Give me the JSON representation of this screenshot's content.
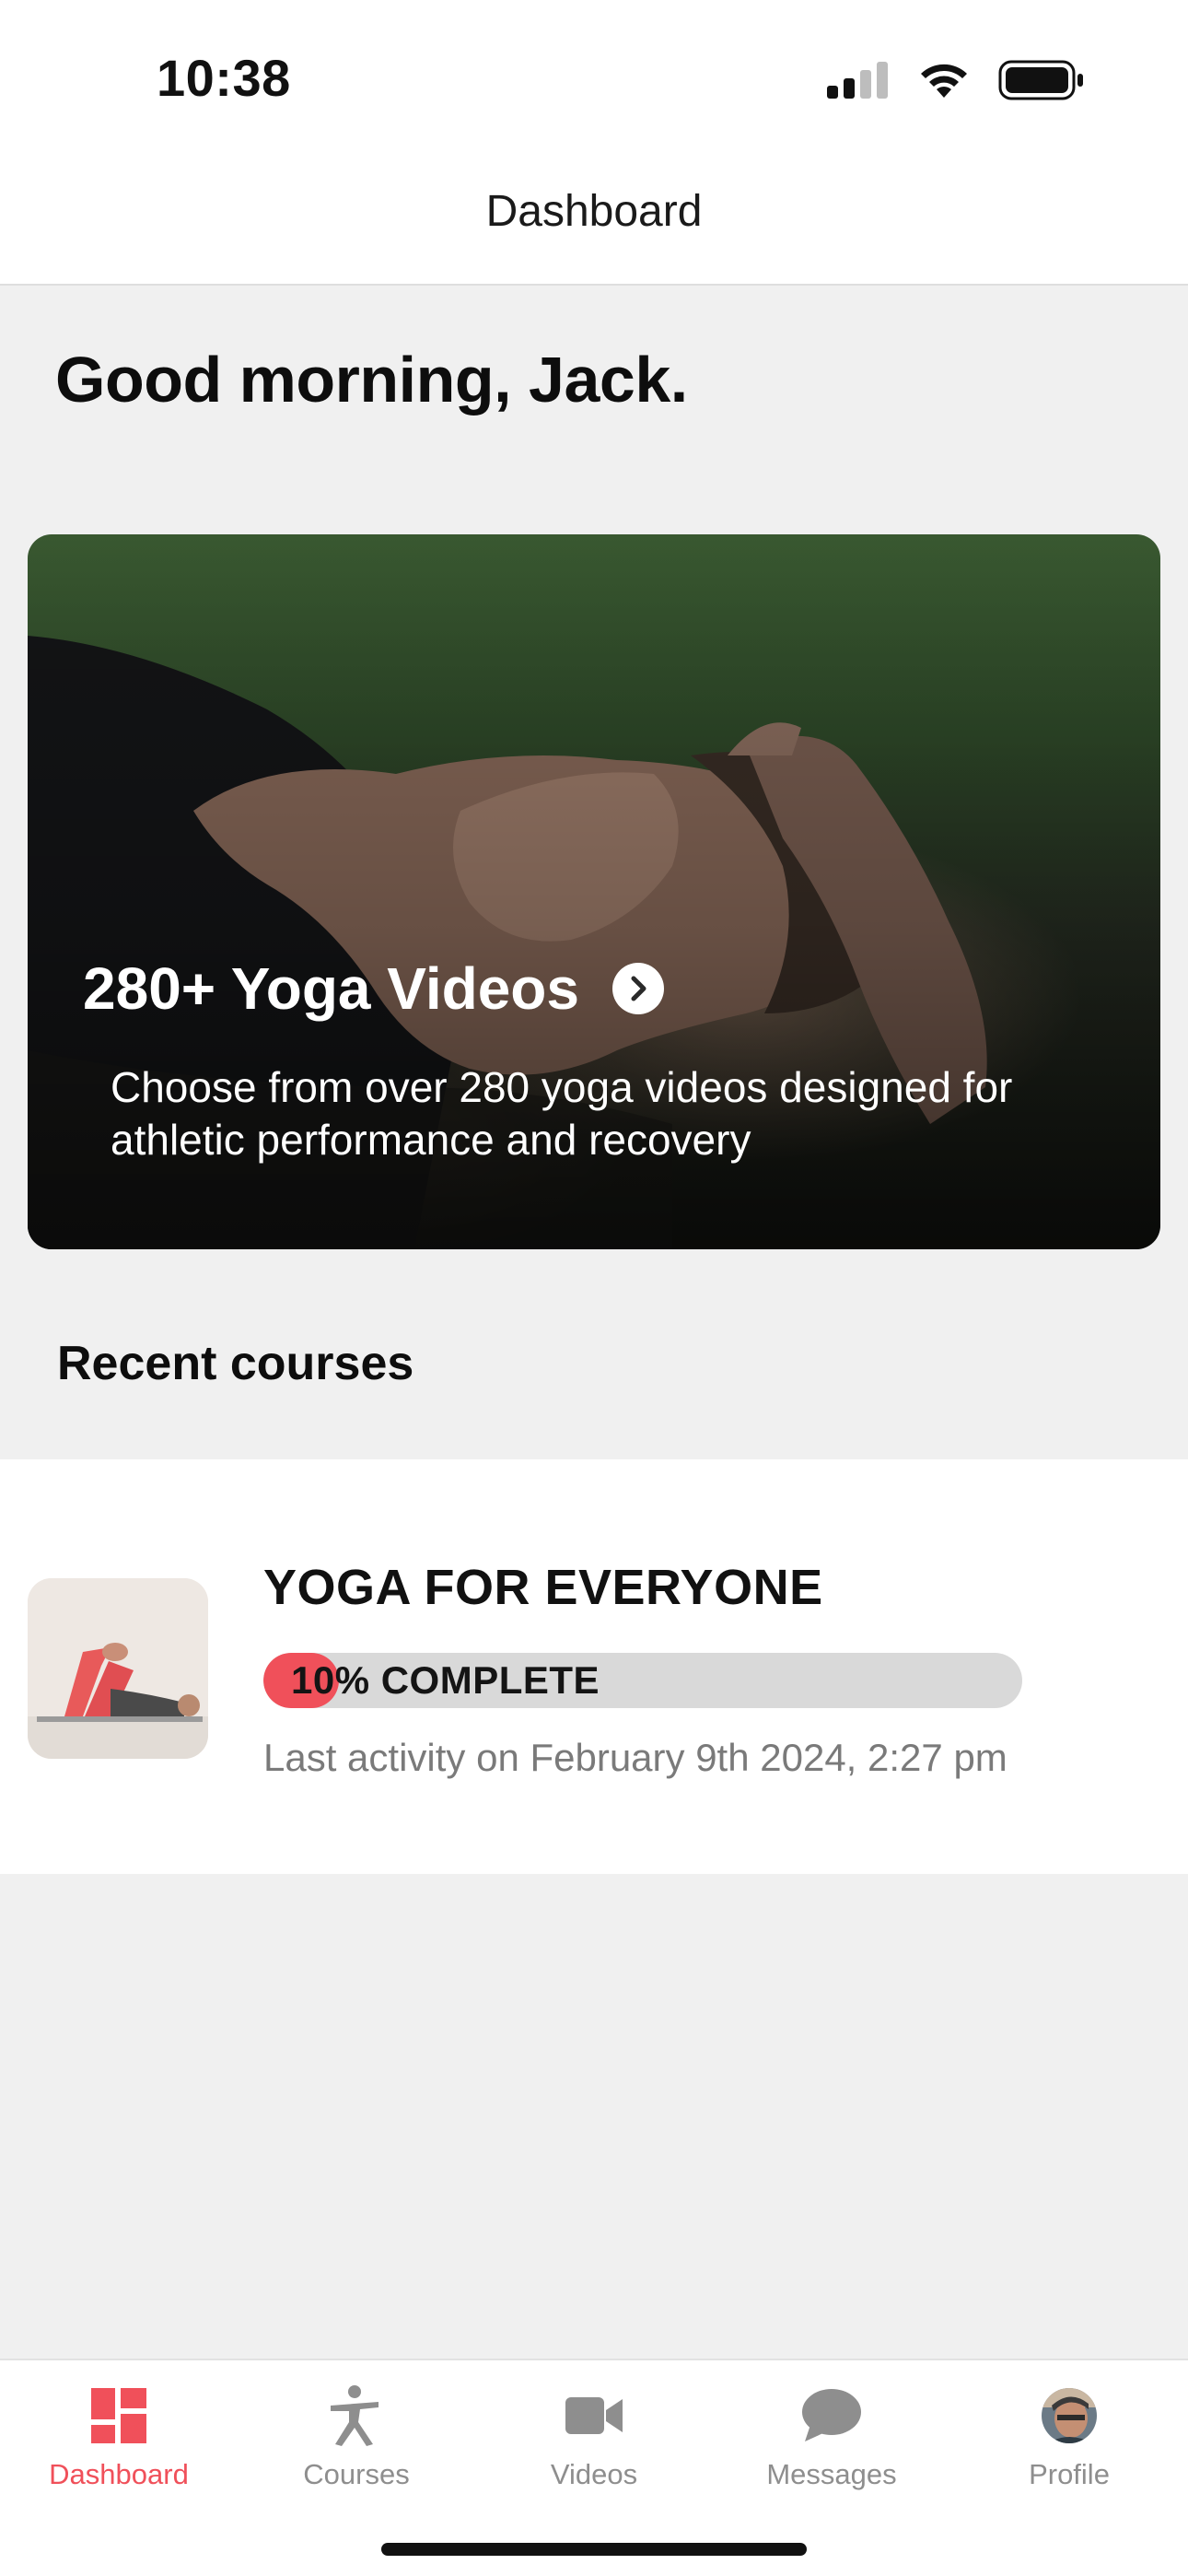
{
  "status_bar": {
    "time": "10:38",
    "icons": [
      "cellular-signal-icon",
      "wifi-icon",
      "battery-icon"
    ]
  },
  "header": {
    "title": "Dashboard"
  },
  "greeting": "Good morning, Jack.",
  "hero": {
    "title": "280+ Yoga Videos",
    "description": "Choose from over 280 yoga videos designed for athletic performance and recovery",
    "arrow_icon": "chevron-right-circle-icon"
  },
  "recent_courses": {
    "section_title": "Recent courses",
    "items": [
      {
        "title": "YOGA FOR EVERYONE",
        "progress_percent": 10,
        "progress_label": "10% COMPLETE",
        "last_activity": "Last activity on February 9th 2024, 2:27 pm"
      }
    ]
  },
  "tab_bar": {
    "items": [
      {
        "label": "Dashboard",
        "icon": "dashboard-grid-icon",
        "active": true
      },
      {
        "label": "Courses",
        "icon": "yoga-pose-icon",
        "active": false
      },
      {
        "label": "Videos",
        "icon": "video-camera-icon",
        "active": false
      },
      {
        "label": "Messages",
        "icon": "chat-bubble-icon",
        "active": false
      },
      {
        "label": "Profile",
        "icon": "profile-avatar-icon",
        "active": false
      }
    ]
  },
  "colors": {
    "accent": "#f0505a",
    "background": "#f0f0f0",
    "inactive_tab": "#8e8e8e",
    "progress_track": "#d9d9d9"
  }
}
